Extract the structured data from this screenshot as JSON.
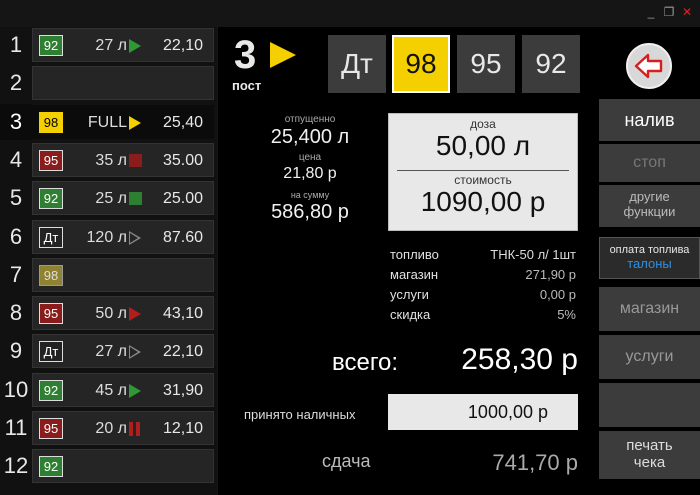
{
  "window": {
    "minimize": "_",
    "restore": "❐",
    "close": "✕",
    "close_color": "#e02020"
  },
  "pumps": [
    {
      "num": "1",
      "grade": "92",
      "volume": "27 л",
      "status": "running",
      "amount": "22,10"
    },
    {
      "num": "2",
      "grade": "",
      "volume": "",
      "status": "none",
      "amount": ""
    },
    {
      "num": "3",
      "grade": "98",
      "volume": "FULL",
      "status": "selected",
      "amount": "25,40"
    },
    {
      "num": "4",
      "grade": "95",
      "volume": "35 л",
      "status": "stopped",
      "amount": "35.00"
    },
    {
      "num": "5",
      "grade": "92",
      "volume": "25 л",
      "status": "done",
      "amount": "25.00"
    },
    {
      "num": "6",
      "grade": "Дт",
      "volume": "120 л",
      "status": "idle",
      "amount": "87.60"
    },
    {
      "num": "7",
      "grade": "98",
      "volume": "",
      "status": "none",
      "amount": ""
    },
    {
      "num": "8",
      "grade": "95",
      "volume": "50 л",
      "status": "running-red",
      "amount": "43,10"
    },
    {
      "num": "9",
      "grade": "Дт",
      "volume": "27 л",
      "status": "idle",
      "amount": "22,10"
    },
    {
      "num": "10",
      "grade": "92",
      "volume": "45 л",
      "status": "running",
      "amount": "31,90"
    },
    {
      "num": "11",
      "grade": "95",
      "volume": "20 л",
      "status": "paused",
      "amount": "12,10"
    },
    {
      "num": "12",
      "grade": "92",
      "volume": "",
      "status": "none",
      "amount": ""
    }
  ],
  "post": {
    "number": "3",
    "label": "пост"
  },
  "fuel_buttons": [
    {
      "label": "Дт",
      "selected": false
    },
    {
      "label": "98",
      "selected": true
    },
    {
      "label": "95",
      "selected": false
    },
    {
      "label": "92",
      "selected": false
    }
  ],
  "back_icon": "arrow-left-icon",
  "dispensed": {
    "released_label": "отпущенно",
    "released_value": "25,400 л",
    "price_label": "цена",
    "price_value": "21,80 р",
    "sum_label": "на сумму",
    "sum_value": "586,80 р"
  },
  "dose": {
    "dose_label": "доза",
    "dose_value": "50,00 л",
    "cost_label": "стоимость",
    "cost_value": "1090,00 р"
  },
  "summary": {
    "fuel_label": "топливо",
    "fuel_value": "ТНК-50 л/ 1шт",
    "shop_label": "магазин",
    "shop_value": "271,90 р",
    "services_label": "услуги",
    "services_value": "0,00 р",
    "discount_label": "скидка",
    "discount_value": "5%"
  },
  "total": {
    "label": "всего:",
    "value": "258,30 р"
  },
  "cash": {
    "label": "принято наличных",
    "value": "1000,00 р"
  },
  "change": {
    "label": "сдача",
    "value": "741,70 р"
  },
  "side": {
    "pour": "налив",
    "stop": "стоп",
    "other_1": "другие",
    "other_2": "функции",
    "payment_title": "оплата топлива",
    "payment_mode": "талоны",
    "payment_mode_color": "#2f8fe0",
    "shop": "магазин",
    "services": "услуги",
    "print_1": "печать",
    "print_2": "чека"
  },
  "colors": {
    "accent_yellow": "#f5d000",
    "grade_92": "#2f7f32",
    "grade_95": "#8a1c1c",
    "running": "#2f9a35",
    "stopped": "#b01e1e"
  }
}
